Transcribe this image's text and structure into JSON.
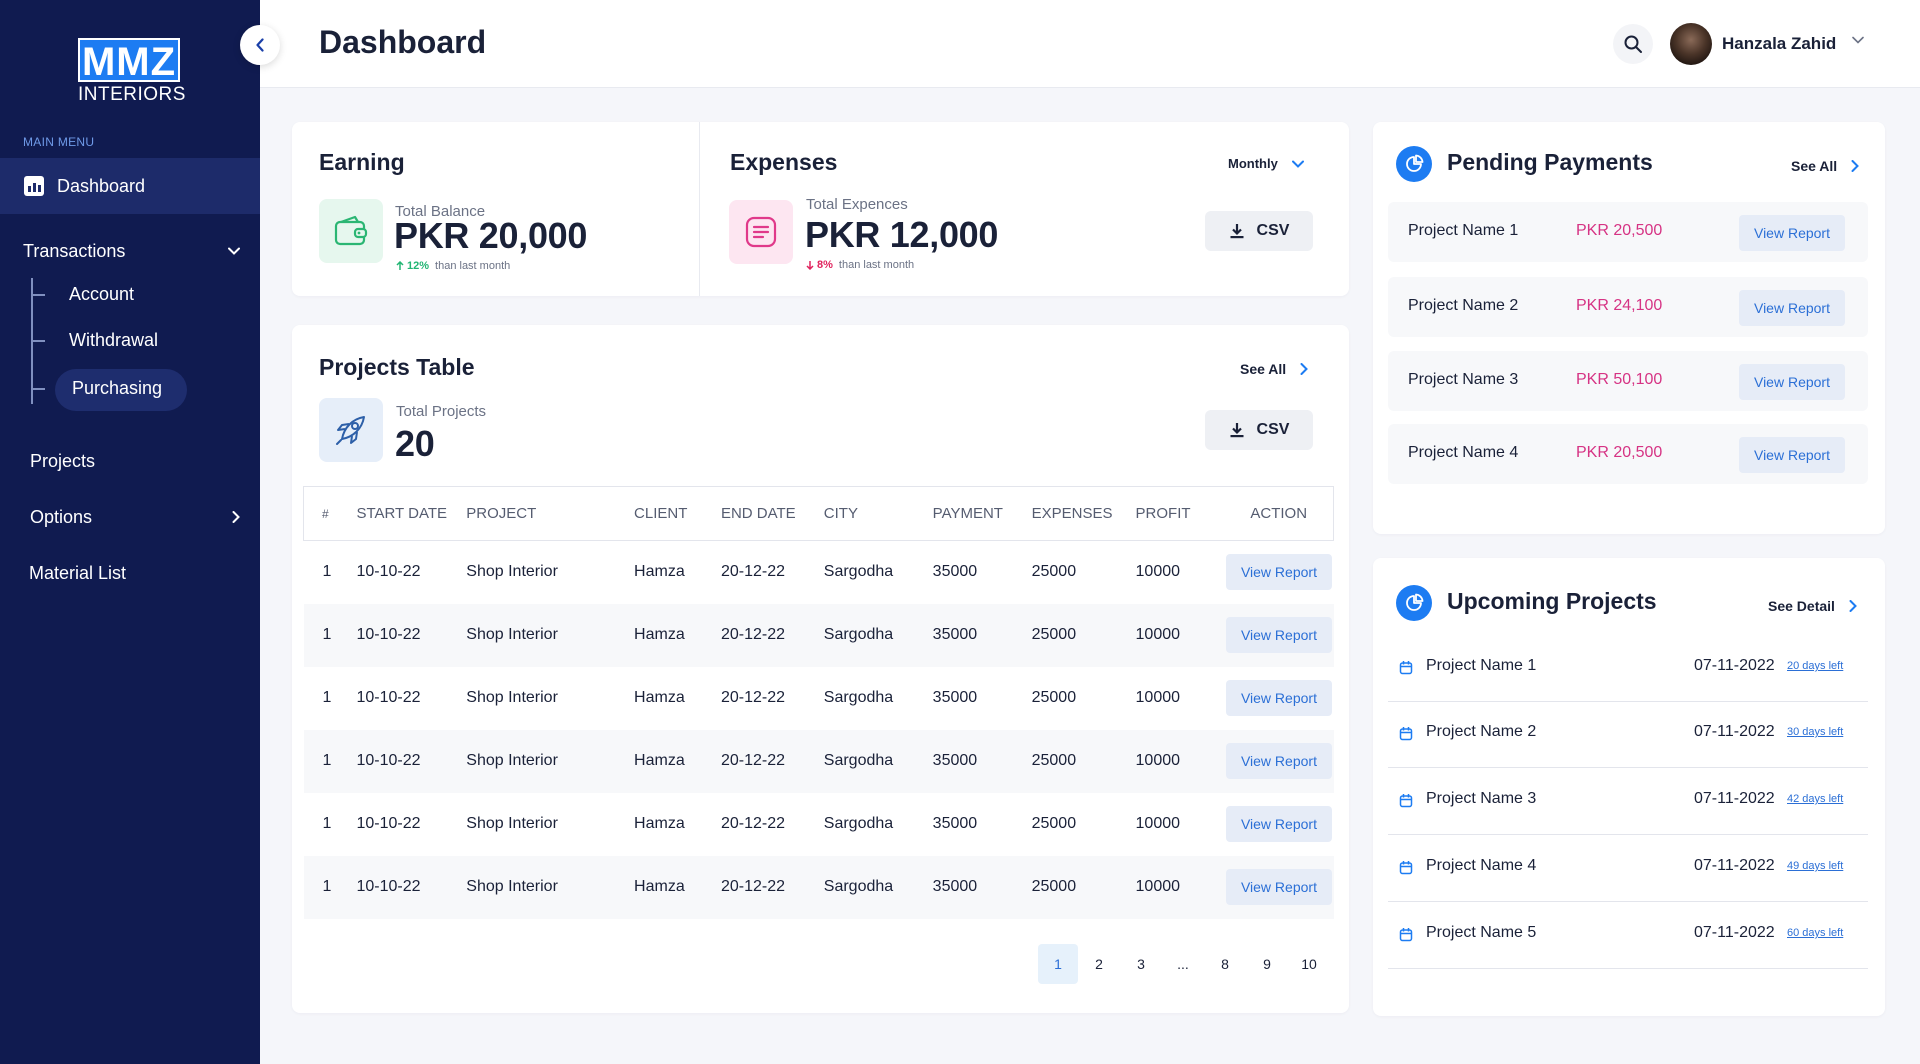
{
  "brand": {
    "logo_main": "MMZ",
    "logo_sub": "INTERIORS"
  },
  "sidebar": {
    "section_label": "MAIN MENU",
    "active_item": "Dashboard",
    "transactions_label": "Transactions",
    "sub_items": [
      "Account",
      "Withdrawal",
      "Purchasing"
    ],
    "items": [
      "Projects",
      "Options",
      "Material List"
    ]
  },
  "header": {
    "title": "Dashboard",
    "user_name": "Hanzala Zahid"
  },
  "earning": {
    "title": "Earning",
    "label": "Total Balance",
    "value": "PKR 20,000",
    "delta": "12%",
    "delta_text": "than last month",
    "delta_color": "#22b573"
  },
  "expenses": {
    "title": "Expenses",
    "period": "Monthly",
    "label": "Total Expences",
    "value": "PKR 12,000",
    "delta": "8%",
    "delta_text": "than last month",
    "delta_color": "#e0245e",
    "csv_label": "CSV"
  },
  "projects": {
    "title": "Projects Table",
    "see_all": "See All",
    "label": "Total Projects",
    "value": "20",
    "csv_label": "CSV",
    "columns": [
      "#",
      "START DATE",
      "PROJECT",
      "CLIENT",
      "END DATE",
      "CITY",
      "PAYMENT",
      "EXPENSES",
      "PROFIT",
      "ACTION"
    ],
    "rows": [
      [
        "1",
        "10-10-22",
        "Shop Interior",
        "Hamza",
        "20-12-22",
        "Sargodha",
        "35000",
        "25000",
        "10000",
        "View Report"
      ],
      [
        "1",
        "10-10-22",
        "Shop Interior",
        "Hamza",
        "20-12-22",
        "Sargodha",
        "35000",
        "25000",
        "10000",
        "View Report"
      ],
      [
        "1",
        "10-10-22",
        "Shop Interior",
        "Hamza",
        "20-12-22",
        "Sargodha",
        "35000",
        "25000",
        "10000",
        "View Report"
      ],
      [
        "1",
        "10-10-22",
        "Shop Interior",
        "Hamza",
        "20-12-22",
        "Sargodha",
        "35000",
        "25000",
        "10000",
        "View Report"
      ],
      [
        "1",
        "10-10-22",
        "Shop Interior",
        "Hamza",
        "20-12-22",
        "Sargodha",
        "35000",
        "25000",
        "10000",
        "View Report"
      ],
      [
        "1",
        "10-10-22",
        "Shop Interior",
        "Hamza",
        "20-12-22",
        "Sargodha",
        "35000",
        "25000",
        "10000",
        "View Report"
      ]
    ],
    "pages": [
      "1",
      "2",
      "3",
      "...",
      "8",
      "9",
      "10"
    ],
    "current_page": "1"
  },
  "pending": {
    "title": "Pending Payments",
    "see_all": "See All",
    "items": [
      {
        "name": "Project Name 1",
        "amount": "PKR 20,500",
        "action": "View Report"
      },
      {
        "name": "Project Name 2",
        "amount": "PKR 24,100",
        "action": "View Report"
      },
      {
        "name": "Project Name 3",
        "amount": "PKR 50,100",
        "action": "View Report"
      },
      {
        "name": "Project Name 4",
        "amount": "PKR 20,500",
        "action": "View Report"
      }
    ]
  },
  "upcoming": {
    "title": "Upcoming Projects",
    "see_detail": "See Detail",
    "items": [
      {
        "name": "Project Name 1",
        "date": "07-11-2022",
        "days_left": "20 days left"
      },
      {
        "name": "Project Name 2",
        "date": "07-11-2022",
        "days_left": "30 days left"
      },
      {
        "name": "Project Name 3",
        "date": "07-11-2022",
        "days_left": "42 days left"
      },
      {
        "name": "Project Name 4",
        "date": "07-11-2022",
        "days_left": "49 days left"
      },
      {
        "name": "Project Name 5",
        "date": "07-11-2022",
        "days_left": "60 days left"
      }
    ]
  },
  "colors": {
    "sidebar": "#101b50",
    "accent": "#1d7cf2",
    "amount": "#d63384",
    "link": "#2b6fd6"
  }
}
